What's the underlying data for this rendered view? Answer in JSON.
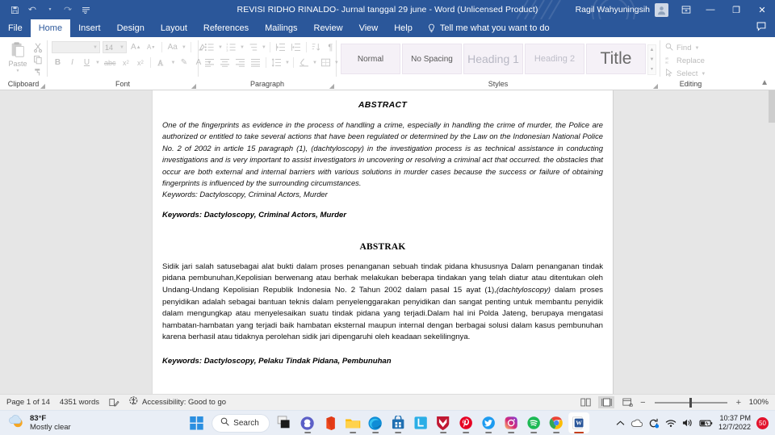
{
  "window": {
    "title": "REVISI RIDHO RINALDO- Jurnal tanggal 29 june  -  Word (Unlicensed Product)",
    "user": "Ragil Wahyuningsih",
    "quick_access": [
      "save-icon",
      "undo-icon",
      "redo-icon",
      "customize-qat-icon"
    ],
    "controls": {
      "ribbon_display": "ribbon-display-options-icon",
      "minimize": "—",
      "restore": "❐",
      "close": "✕"
    }
  },
  "tabs": {
    "items": [
      {
        "label": "File",
        "active": false
      },
      {
        "label": "Home",
        "active": true
      },
      {
        "label": "Insert",
        "active": false
      },
      {
        "label": "Design",
        "active": false
      },
      {
        "label": "Layout",
        "active": false
      },
      {
        "label": "References",
        "active": false
      },
      {
        "label": "Mailings",
        "active": false
      },
      {
        "label": "Review",
        "active": false
      },
      {
        "label": "View",
        "active": false
      },
      {
        "label": "Help",
        "active": false
      }
    ],
    "tell_me": "Tell me what you want to do",
    "comments_icon": "comments-icon"
  },
  "ribbon": {
    "clipboard": {
      "label": "Clipboard",
      "paste": "Paste"
    },
    "font": {
      "label": "Font",
      "font_name": "",
      "font_size": "14",
      "buttons": [
        "Bold",
        "Italic",
        "Underline",
        "Strikethrough",
        "Subscript",
        "Superscript",
        "Text Effects",
        "Text Highlight Color",
        "Font Color",
        "Grow Font",
        "Shrink Font",
        "Change Case",
        "Clear Formatting"
      ]
    },
    "paragraph": {
      "label": "Paragraph"
    },
    "styles": {
      "label": "Styles",
      "gallery": [
        {
          "name": "Normal",
          "variant": "normal"
        },
        {
          "name": "No Spacing",
          "variant": "normal"
        },
        {
          "name": "Heading 1",
          "variant": "h1"
        },
        {
          "name": "Heading 2",
          "variant": "h2"
        },
        {
          "name": "Title",
          "variant": "title"
        }
      ]
    },
    "editing": {
      "label": "Editing",
      "find": "Find",
      "replace": "Replace",
      "select": "Select"
    },
    "collapse_icon": "collapse-ribbon-icon"
  },
  "document": {
    "abstract_heading": "ABSTRACT",
    "abstract_body": "One of the fingerprints as evidence in the process of handling a crime, especially in handling the crime of murder, the Police are authorized or entitled to take several actions that have been regulated or determined by the Law on the Indonesian National Police No. 2 of 2002 in article 15 paragraph (1), (dachtyloscopy) in the investigation process is as technical assistance in conducting investigations and is very important to assist investigators in uncovering or resolving a criminal act that occurred. the obstacles that occur are both external and internal barriers with various solutions in murder cases because the success or failure of obtaining fingerprints is influenced by the surrounding circumstances.",
    "abstract_keywords_plain": "Keywords: Dactyloscopy, Criminal Actors, Murder",
    "abstract_keywords_bold": "Keywords: Dactyloscopy, Criminal Actors, Murder",
    "abstrak_heading": "ABSTRAK",
    "abstrak_body": "Sidik jari salah satusebagai alat bukti dalam proses penanganan sebuah tindak pidana khususnya Dalam penanganan tindak pidana pembunuhan,Kepolisian berwenang atau berhak melakukan beberapa tindakan yang telah diatur atau ditentukan oleh Undang-Undang Kepolisian Republik Indonesia No. 2 Tahun 2002 dalam pasal 15 ayat (1),",
    "abstrak_body_italic": "(dachtyloscopy)",
    "abstrak_body_2": " dalam proses penyidikan adalah sebagai bantuan teknis dalam penyelenggarakan penyidikan dan sangat penting untuk membantu penyidik dalam mengungkap atau menyelesaikan suatu tindak pidana yang terjadi.Dalam hal ini Polda Jateng, berupaya mengatasi hambatan-hambatan yang terjadi baik hambatan eksternal maupun internal dengan berbagai solusi dalam kasus pembunuhan karena berhasil atau tidaknya perolehan sidik jari dipengaruhi oleh keadaan sekelilingnya.",
    "abstrak_keywords_bold": "Keywords: Dactyloscopy, Pelaku Tindak Pidana, Pembunuhan"
  },
  "status_bar": {
    "page": "Page 1 of 14",
    "words": "4351 words",
    "proofing_icon": "proofing-errors-icon",
    "accessibility": "Accessibility: Good to go",
    "views": [
      "read-mode-icon",
      "print-layout-icon",
      "web-layout-icon"
    ],
    "zoom_out": "−",
    "zoom_in": "+",
    "zoom_level": "100%"
  },
  "taskbar": {
    "weather": {
      "temp": "83°F",
      "condition": "Mostly clear",
      "icon": "partly-cloudy-icon"
    },
    "start": "start-button-icon",
    "search_placeholder": "Search",
    "apps": [
      {
        "name": "task-view",
        "color": "#1b1b1b"
      },
      {
        "name": "microsoft-teams",
        "color": "#5b5fc7"
      },
      {
        "name": "microsoft-office",
        "color": "#e63a16"
      },
      {
        "name": "file-explorer",
        "color": "#ffb900"
      },
      {
        "name": "microsoft-edge",
        "color": "#0f8dd6"
      },
      {
        "name": "microsoft-store",
        "color": "#1f6fb2"
      },
      {
        "name": "lightshot",
        "color": "#2aaee6"
      },
      {
        "name": "mcafee",
        "color": "#c01933"
      },
      {
        "name": "pinterest",
        "color": "#e60023"
      },
      {
        "name": "twitter",
        "color": "#1d9bf0"
      },
      {
        "name": "instagram",
        "color": "#d62976"
      },
      {
        "name": "spotify",
        "color": "#1db954"
      },
      {
        "name": "google-chrome",
        "color": "#4285f4"
      },
      {
        "name": "microsoft-word",
        "color": "#2b579a"
      }
    ],
    "tray": {
      "overflow": "show-hidden-icons-chevron",
      "onedrive": "onedrive-icon",
      "update": "windows-update-icon",
      "wifi": "wifi-icon",
      "volume": "volume-icon",
      "battery": "battery-charging-icon",
      "time": "10:37 PM",
      "date": "12/7/2022",
      "notification_count": "50"
    }
  },
  "colors": {
    "word_blue": "#2b579a",
    "ribbon_bg": "#ffffff",
    "doc_bg": "#e6e6e6",
    "taskbar_bg": "#e9eef6",
    "accent_red": "#e2142d"
  }
}
